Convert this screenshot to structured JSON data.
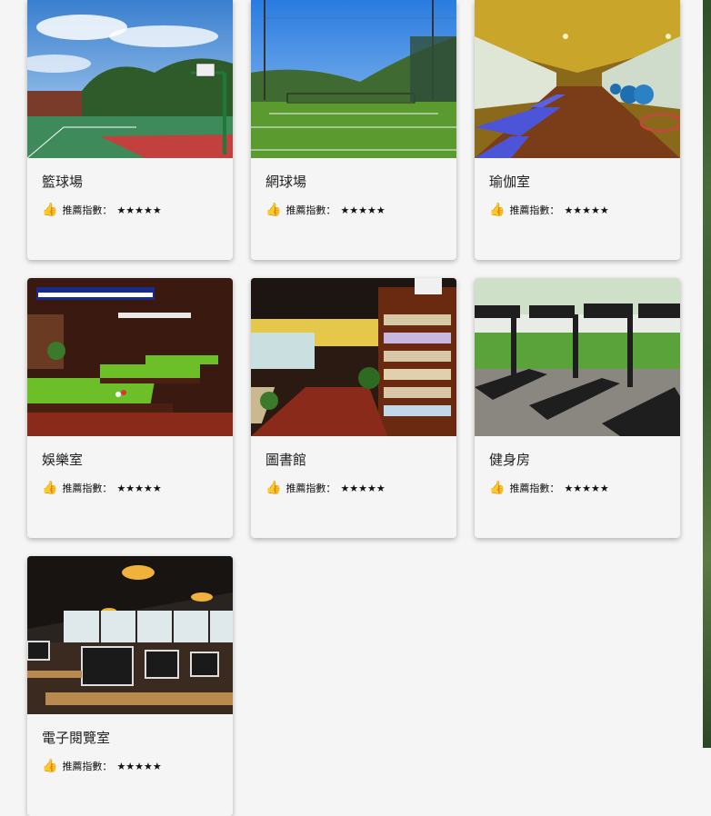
{
  "facilities": [
    {
      "name": "籃球場",
      "rating_label": "推薦指數：",
      "stars": "★★★★★",
      "icon": "thumbs-up-icon",
      "scene": "basketball-court"
    },
    {
      "name": "網球場",
      "rating_label": "推薦指數：",
      "stars": "★★★★★",
      "icon": "thumbs-up-icon",
      "scene": "tennis-court"
    },
    {
      "name": "瑜伽室",
      "rating_label": "推薦指數：",
      "stars": "★★★★★",
      "icon": "thumbs-up-icon",
      "scene": "yoga-room"
    },
    {
      "name": "娛樂室",
      "rating_label": "推薦指數：",
      "stars": "★★★★★",
      "icon": "thumbs-up-icon",
      "scene": "billiards-room"
    },
    {
      "name": "圖書館",
      "rating_label": "推薦指數：",
      "stars": "★★★★★",
      "icon": "thumbs-up-icon",
      "scene": "library"
    },
    {
      "name": "健身房",
      "rating_label": "推薦指數：",
      "stars": "★★★★★",
      "icon": "thumbs-up-icon",
      "scene": "gym"
    },
    {
      "name": "電子閱覽室",
      "rating_label": "推薦指數：",
      "stars": "★★★★★",
      "icon": "thumbs-up-icon",
      "scene": "computer-room"
    }
  ],
  "colors": {
    "page_bg": "#f5f5f5",
    "card_bg": "#f5f5f5",
    "thumb_icon": "#f4b400"
  }
}
